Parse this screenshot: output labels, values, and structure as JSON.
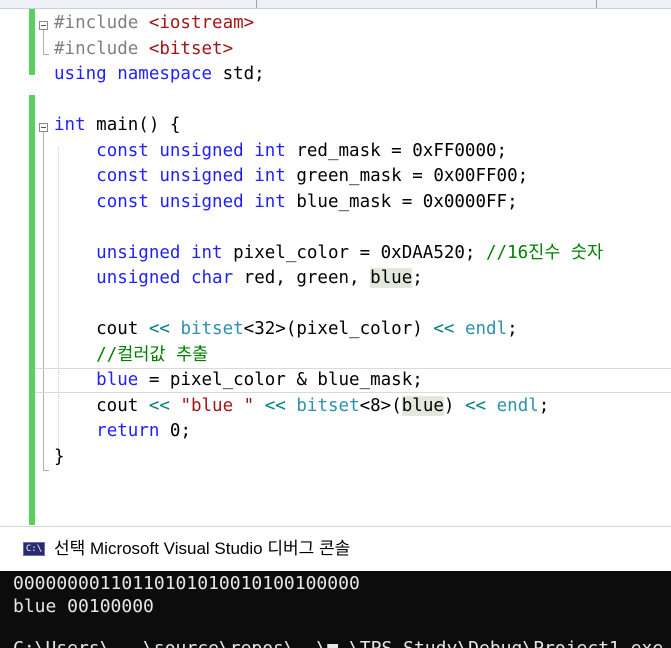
{
  "editor": {
    "lines": [
      {
        "parts": [
          {
            "t": "#include ",
            "c": "inc"
          },
          {
            "t": "<iostream>",
            "c": "str"
          }
        ]
      },
      {
        "parts": [
          {
            "t": "#include ",
            "c": "inc"
          },
          {
            "t": "<bitset>",
            "c": "str"
          }
        ]
      },
      {
        "parts": [
          {
            "t": "using ",
            "c": "kw"
          },
          {
            "t": "namespace ",
            "c": "kw"
          },
          {
            "t": "std;",
            "c": ""
          }
        ]
      },
      {
        "parts": []
      },
      {
        "parts": [
          {
            "t": "int ",
            "c": "kw"
          },
          {
            "t": "main() {",
            "c": ""
          }
        ]
      },
      {
        "parts": [
          {
            "t": "    ",
            "c": ""
          },
          {
            "t": "const ",
            "c": "kw"
          },
          {
            "t": "unsigned ",
            "c": "kw"
          },
          {
            "t": "int ",
            "c": "kw"
          },
          {
            "t": "red_mask = 0xFF0000;",
            "c": ""
          }
        ]
      },
      {
        "parts": [
          {
            "t": "    ",
            "c": ""
          },
          {
            "t": "const ",
            "c": "kw"
          },
          {
            "t": "unsigned ",
            "c": "kw"
          },
          {
            "t": "int ",
            "c": "kw"
          },
          {
            "t": "green_mask = 0x00FF00;",
            "c": ""
          }
        ]
      },
      {
        "parts": [
          {
            "t": "    ",
            "c": ""
          },
          {
            "t": "const ",
            "c": "kw"
          },
          {
            "t": "unsigned ",
            "c": "kw"
          },
          {
            "t": "int ",
            "c": "kw"
          },
          {
            "t": "blue_mask = 0x0000FF;",
            "c": ""
          }
        ]
      },
      {
        "parts": []
      },
      {
        "parts": [
          {
            "t": "    ",
            "c": ""
          },
          {
            "t": "unsigned ",
            "c": "kw"
          },
          {
            "t": "int ",
            "c": "kw"
          },
          {
            "t": "pixel_color = 0xDAA520; ",
            "c": ""
          },
          {
            "t": "//16진수 숫자",
            "c": "cm"
          }
        ]
      },
      {
        "parts": [
          {
            "t": "    ",
            "c": ""
          },
          {
            "t": "unsigned ",
            "c": "kw"
          },
          {
            "t": "char ",
            "c": "kw"
          },
          {
            "t": "red, green, ",
            "c": ""
          },
          {
            "t": "blue",
            "c": "hl"
          },
          {
            "t": ";",
            "c": ""
          }
        ]
      },
      {
        "parts": []
      },
      {
        "parts": [
          {
            "t": "    cout ",
            "c": ""
          },
          {
            "t": "<<",
            "c": "op"
          },
          {
            "t": " ",
            "c": ""
          },
          {
            "t": "bitset",
            "c": "typ"
          },
          {
            "t": "<32>(pixel_color) ",
            "c": ""
          },
          {
            "t": "<<",
            "c": "op"
          },
          {
            "t": " ",
            "c": ""
          },
          {
            "t": "endl",
            "c": "typ"
          },
          {
            "t": ";",
            "c": ""
          }
        ]
      },
      {
        "parts": [
          {
            "t": "    ",
            "c": ""
          },
          {
            "t": "//컬러값 추출",
            "c": "cm"
          }
        ]
      },
      {
        "current": true,
        "parts": [
          {
            "t": "    ",
            "c": ""
          },
          {
            "t": "blue",
            "c": "kw"
          },
          {
            "t": " = pixel_color & blue_mask;",
            "c": ""
          }
        ]
      },
      {
        "parts": [
          {
            "t": "    cout ",
            "c": ""
          },
          {
            "t": "<<",
            "c": "op"
          },
          {
            "t": " ",
            "c": ""
          },
          {
            "t": "\"blue \"",
            "c": "str"
          },
          {
            "t": " ",
            "c": ""
          },
          {
            "t": "<<",
            "c": "op"
          },
          {
            "t": " ",
            "c": ""
          },
          {
            "t": "bitset",
            "c": "typ"
          },
          {
            "t": "<8>(",
            "c": ""
          },
          {
            "t": "blue",
            "c": "hl"
          },
          {
            "t": ") ",
            "c": ""
          },
          {
            "t": "<<",
            "c": "op"
          },
          {
            "t": " ",
            "c": ""
          },
          {
            "t": "endl",
            "c": "typ"
          },
          {
            "t": ";",
            "c": ""
          }
        ]
      },
      {
        "parts": [
          {
            "t": "    ",
            "c": ""
          },
          {
            "t": "return ",
            "c": "kw"
          },
          {
            "t": "0;",
            "c": ""
          }
        ]
      },
      {
        "parts": [
          {
            "t": "}",
            "c": ""
          }
        ]
      }
    ]
  },
  "console": {
    "title": "선택 Microsoft Visual Studio 디버그 콘솔",
    "icon_label": "C:\\",
    "output": [
      "00000000110110101010010100100000",
      "blue 00100000",
      "",
      "C:\\Users\\...\\source\\repos\\..\\■ \\TPS_Study\\Debug\\Project1.exe"
    ]
  },
  "colors": {
    "keyword": "#1f1fff",
    "string": "#a31515",
    "comment": "#008000",
    "type": "#2b91af",
    "change_bar": "#5bd05b",
    "console_bg": "#0c0c0c"
  }
}
